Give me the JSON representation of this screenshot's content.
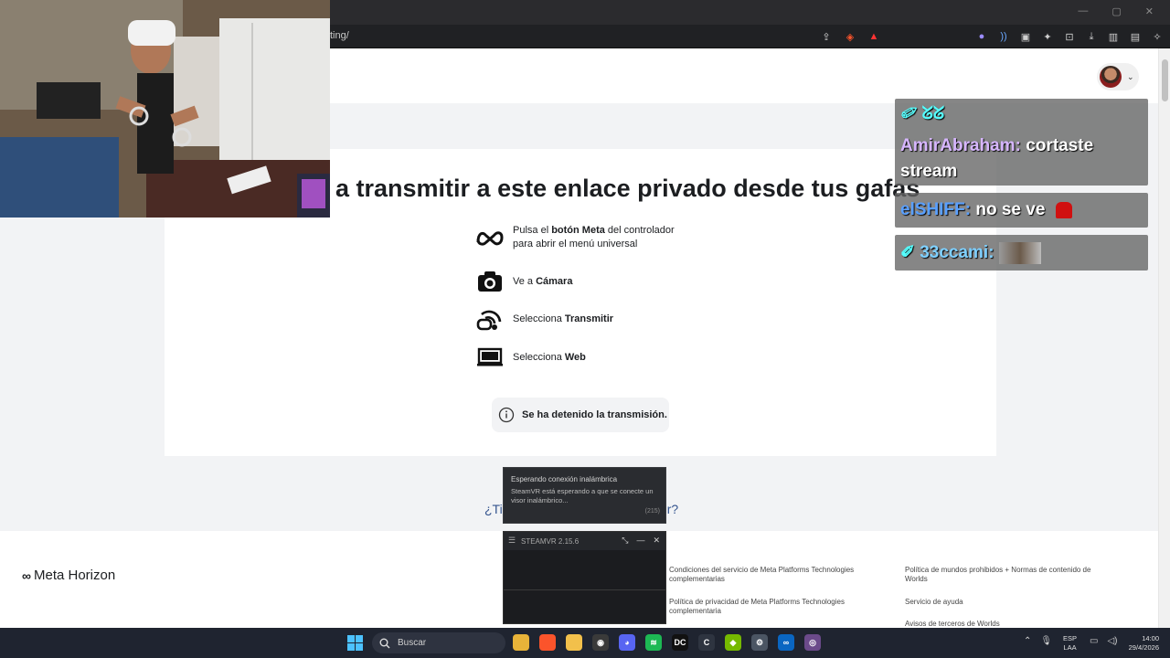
{
  "browser": {
    "url": "ting/",
    "window_controls": [
      "—",
      "▢",
      "✕"
    ]
  },
  "header": {
    "avatar_alt": "perfil"
  },
  "main": {
    "headline": "a transmitir a este enlace privado desde tus gafas",
    "steps": [
      {
        "icon": "meta-logo-icon",
        "pre": "Pulsa el ",
        "bold": "botón Meta",
        "post": " del controlador",
        "line2": "para abrir el menú universal"
      },
      {
        "icon": "camera-icon",
        "pre": "Ve a ",
        "bold": "Cámara",
        "post": "",
        "line2": ""
      },
      {
        "icon": "cast-icon",
        "pre": "Selecciona ",
        "bold": "Transmitir",
        "post": "",
        "line2": ""
      },
      {
        "icon": "laptop-icon",
        "pre": "Selecciona ",
        "bold": "Web",
        "post": "",
        "line2": ""
      }
    ],
    "status": "Se ha detenido la transmisión.",
    "question_left": "¿Ti",
    "question_right": "r?"
  },
  "footer": {
    "logo_text": "Meta Horizon",
    "links": [
      "Condiciones del servicio de Meta Platforms Technologies complementarias",
      "Política de privacidad de Meta Platforms Technologies complementaria",
      "Política de mundos prohibidos + Normas de contenido de Worlds",
      "Servicio de ayuda",
      "Avisos de terceros de Worlds"
    ]
  },
  "chat": {
    "messages": [
      {
        "user": "AmirAbraham:",
        "text": "cortaste",
        "text2": "stream",
        "user_color": "#d7b6ff"
      },
      {
        "user": "elSHIFF:",
        "text": "no se ve",
        "text2": "",
        "user_color": "#5aa0ff"
      },
      {
        "user": "33ccami:",
        "text": "",
        "text2": "",
        "user_color": "#7fd0ff"
      }
    ]
  },
  "steamvr": {
    "notif_title": "Esperando conexión inalámbrica",
    "notif_body": "SteamVR está esperando a que se conecte un visor inalámbrico...",
    "notif_count": "(215)",
    "window_title": "STEAMVR 2.15.6"
  },
  "taskbar": {
    "search_label": "Buscar",
    "lang_line1": "ESP",
    "lang_line2": "LAA",
    "time": "14:00",
    "date": "29/4/2026",
    "apps": [
      {
        "name": "file-explorer-icon",
        "color": "#e8b339",
        "glyph": ""
      },
      {
        "name": "brave-icon",
        "color": "#fb542b",
        "glyph": ""
      },
      {
        "name": "folder-icon",
        "color": "#f2c04b",
        "glyph": ""
      },
      {
        "name": "obs-icon",
        "color": "#3a3a3a",
        "glyph": "◉"
      },
      {
        "name": "discord-icon",
        "color": "#5865f2",
        "glyph": "◕"
      },
      {
        "name": "spotify-icon",
        "color": "#1db954",
        "glyph": "≋"
      },
      {
        "name": "dc-icon",
        "color": "#111",
        "glyph": "DC"
      },
      {
        "name": "c-icon",
        "color": "#2e3440",
        "glyph": "C"
      },
      {
        "name": "nvidia-icon",
        "color": "#76b900",
        "glyph": "◆"
      },
      {
        "name": "settings-icon",
        "color": "#4b5563",
        "glyph": "⚙"
      },
      {
        "name": "meta-icon",
        "color": "#0a66c2",
        "glyph": "∞"
      },
      {
        "name": "steamvr-icon",
        "color": "#6b4a8a",
        "glyph": "◎"
      }
    ]
  }
}
